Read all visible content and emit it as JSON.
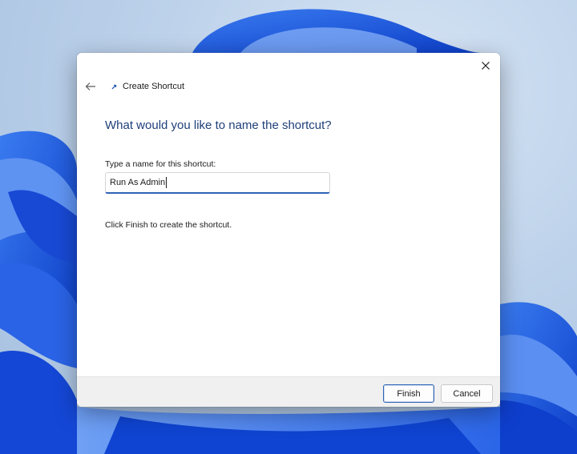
{
  "dialog": {
    "header_title": "Create Shortcut",
    "heading": "What would you like to name the shortcut?",
    "name_field": {
      "label": "Type a name for this shortcut:",
      "value": "Run As Admin"
    },
    "hint": "Click Finish to create the shortcut.",
    "buttons": {
      "finish": "Finish",
      "cancel": "Cancel"
    },
    "icons": {
      "close": "close-icon",
      "back": "back-arrow-icon",
      "wizard": "shortcut-wizard-icon"
    }
  },
  "colors": {
    "heading": "#1f3f7a",
    "accent": "#2f63b5",
    "wallpaper_blue": "#1a55e0"
  }
}
